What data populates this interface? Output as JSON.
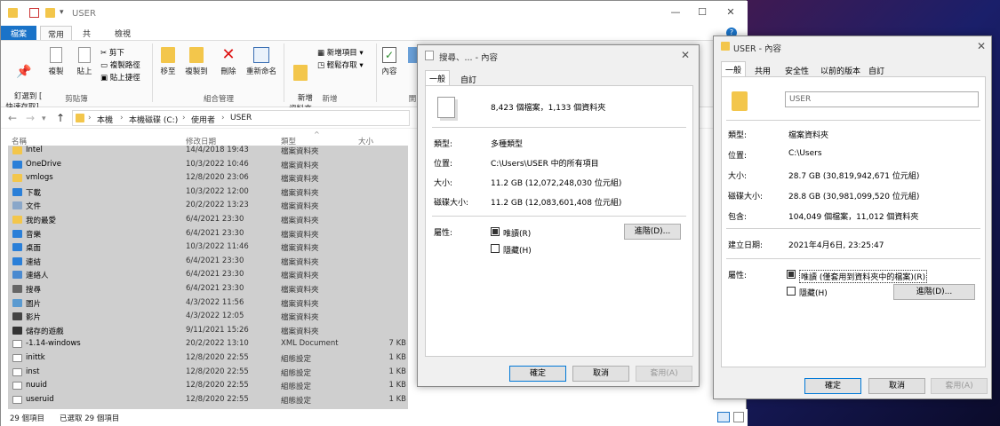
{
  "explorer": {
    "title": "USER",
    "window_controls": [
      "—",
      "☐",
      "✕"
    ],
    "ribbon_tabs": [
      "檔案",
      "常用",
      "共用",
      "檢視"
    ],
    "ribbon": {
      "pin": "釘選到 [\n快速存取]",
      "copy": "複製",
      "paste": "貼上",
      "cut": "剪下",
      "copy_path": "複製路徑",
      "paste_shortcut": "貼上捷徑",
      "group_clipboard": "剪貼簿",
      "move_to": "移至",
      "copy_to": "複製到",
      "delete": "刪除",
      "rename": "重新命名",
      "group_organize": "組合管理",
      "new_folder": "新增\n資料夾",
      "new_item": "新增項目 ▾",
      "easy_access": "輕鬆存取 ▾",
      "group_new": "新增",
      "properties": "內容",
      "group_open_short": "開"
    },
    "breadcrumb": [
      "本機",
      "本機磁碟 (C:)",
      "使用者",
      "USER"
    ],
    "columns": {
      "name": "名稱",
      "date": "修改日期",
      "type": "類型",
      "size": "大小"
    },
    "rows": [
      {
        "name": "Intel",
        "date": "14/4/2018 19:43",
        "type": "檔案資料夾",
        "size": "",
        "icon": "folder"
      },
      {
        "name": "OneDrive",
        "date": "10/3/2022 10:46",
        "type": "檔案資料夾",
        "size": "",
        "icon": "cloud"
      },
      {
        "name": "vmlogs",
        "date": "12/8/2020 23:06",
        "type": "檔案資料夾",
        "size": "",
        "icon": "folder"
      },
      {
        "name": "下載",
        "date": "10/3/2022 12:00",
        "type": "檔案資料夾",
        "size": "",
        "icon": "download"
      },
      {
        "name": "文件",
        "date": "20/2/2022 13:23",
        "type": "檔案資料夾",
        "size": "",
        "icon": "doc"
      },
      {
        "name": "我的最愛",
        "date": "6/4/2021 23:30",
        "type": "檔案資料夾",
        "size": "",
        "icon": "star"
      },
      {
        "name": "音樂",
        "date": "6/4/2021 23:30",
        "type": "檔案資料夾",
        "size": "",
        "icon": "music"
      },
      {
        "name": "桌面",
        "date": "10/3/2022 11:46",
        "type": "檔案資料夾",
        "size": "",
        "icon": "desktop"
      },
      {
        "name": "連結",
        "date": "6/4/2021 23:30",
        "type": "檔案資料夾",
        "size": "",
        "icon": "link"
      },
      {
        "name": "連絡人",
        "date": "6/4/2021 23:30",
        "type": "檔案資料夾",
        "size": "",
        "icon": "contacts"
      },
      {
        "name": "搜尋",
        "date": "6/4/2021 23:30",
        "type": "檔案資料夾",
        "size": "",
        "icon": "search"
      },
      {
        "name": "圖片",
        "date": "4/3/2022 11:56",
        "type": "檔案資料夾",
        "size": "",
        "icon": "picture"
      },
      {
        "name": "影片",
        "date": "4/3/2022 12:05",
        "type": "檔案資料夾",
        "size": "",
        "icon": "video"
      },
      {
        "name": "儲存的遊戲",
        "date": "9/11/2021 15:26",
        "type": "檔案資料夾",
        "size": "",
        "icon": "game"
      },
      {
        "name": "-1.14-windows",
        "date": "20/2/2022 13:10",
        "type": "XML Document",
        "size": "7 KB",
        "icon": "file"
      },
      {
        "name": "inittk",
        "date": "12/8/2020 22:55",
        "type": "組態設定",
        "size": "1 KB",
        "icon": "file"
      },
      {
        "name": "inst",
        "date": "12/8/2020 22:55",
        "type": "組態設定",
        "size": "1 KB",
        "icon": "file"
      },
      {
        "name": "nuuid",
        "date": "12/8/2020 22:55",
        "type": "組態設定",
        "size": "1 KB",
        "icon": "file"
      },
      {
        "name": "useruid",
        "date": "12/8/2020 22:55",
        "type": "組態設定",
        "size": "1 KB",
        "icon": "file"
      }
    ],
    "status": {
      "count": "29 個項目",
      "selected": "已選取 29 個項目"
    }
  },
  "dialog1": {
    "title": "搜尋、... - 內容",
    "tabs": [
      "一般",
      "自訂"
    ],
    "summary": "8,423 個檔案，1,133 個資料夾",
    "type_label": "類型:",
    "type_value": "多種類型",
    "location_label": "位置:",
    "location_value": "C:\\Users\\USER 中的所有項目",
    "size_label": "大小:",
    "size_value": "11.2 GB (12,072,248,030 位元組)",
    "disk_label": "磁碟大小:",
    "disk_value": "11.2 GB (12,083,601,408 位元組)",
    "attr_label": "屬性:",
    "readonly": "唯讀(R)",
    "hidden": "隱藏(H)",
    "advanced": "進階(D)...",
    "ok": "確定",
    "cancel": "取消",
    "apply": "套用(A)"
  },
  "dialog2": {
    "title": "USER - 內容",
    "tabs": [
      "一般",
      "共用",
      "安全性",
      "以前的版本",
      "自訂"
    ],
    "name_value": "USER",
    "type_label": "類型:",
    "type_value": "檔案資料夾",
    "location_label": "位置:",
    "location_value": "C:\\Users",
    "size_label": "大小:",
    "size_value": "28.7 GB (30,819,942,671 位元組)",
    "disk_label": "磁碟大小:",
    "disk_value": "28.8 GB (30,981,099,520 位元組)",
    "contains_label": "包含:",
    "contains_value": "104,049 個檔案，11,012 個資料夾",
    "created_label": "建立日期:",
    "created_value": "2021年4月6日, 23:25:47",
    "attr_label": "屬性:",
    "readonly": "唯讀 (僅套用到資料夾中的檔案)(R)",
    "hidden": "隱藏(H)",
    "advanced": "進階(D)...",
    "ok": "確定",
    "cancel": "取消",
    "apply": "套用(A)"
  }
}
